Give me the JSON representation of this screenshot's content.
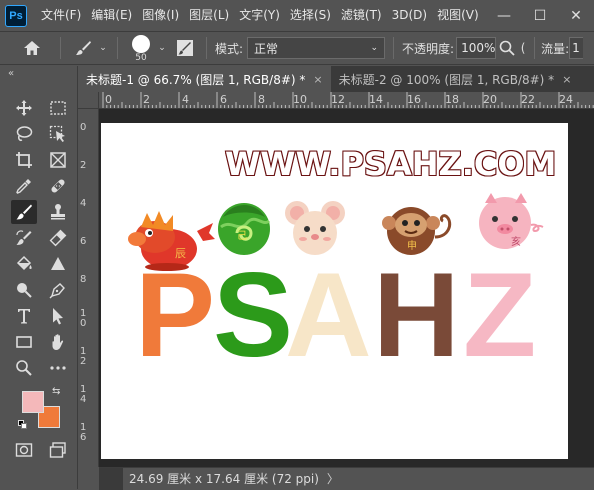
{
  "app": {
    "logo": "Ps"
  },
  "menu": [
    "文件(F)",
    "编辑(E)",
    "图像(I)",
    "图层(L)",
    "文字(Y)",
    "选择(S)",
    "滤镜(T)",
    "3D(D)",
    "视图(V)"
  ],
  "window_controls": {
    "minimize": "—",
    "maximize": "☐",
    "close": "✕"
  },
  "options": {
    "brush_size": "50",
    "mode_label": "模式:",
    "mode_value": "正常",
    "opacity_label": "不透明度:",
    "opacity_value": "100%",
    "flow_label": "流量:",
    "flow_value": "1"
  },
  "tabs": [
    {
      "label": "未标题-1 @ 66.7% (图层 1, RGB/8#) *",
      "close": "×",
      "active": true
    },
    {
      "label": "未标题-2 @ 100% (图层 1, RGB/8#) *",
      "close": "×",
      "active": false
    }
  ],
  "ruler_top": [
    "0",
    "2",
    "4",
    "6",
    "8",
    "10",
    "12",
    "14",
    "16",
    "18",
    "20",
    "22",
    "24"
  ],
  "ruler_left": [
    "0",
    "2",
    "4",
    "6",
    "8",
    "1 0",
    "1 2",
    "1 4",
    "1 6"
  ],
  "canvas": {
    "title": "WWW.PSAHZ.COM",
    "letters": [
      {
        "char": "P",
        "color": "#f07a3a"
      },
      {
        "char": "S",
        "color": "#2c9a1a"
      },
      {
        "char": "A",
        "color": "#f7e6c8"
      },
      {
        "char": "H",
        "color": "#7a4a38"
      },
      {
        "char": "Z",
        "color": "#f6b8c4"
      }
    ],
    "mascots": [
      "dragon",
      "snake",
      "mouse",
      "monkey",
      "pig"
    ]
  },
  "colors": {
    "foreground": "#f4b8ba",
    "background": "#f07a3a"
  },
  "status": {
    "doc_size": "24.69 厘米 x 17.64 厘米 (72 ppi)",
    "arrow": "〉"
  }
}
